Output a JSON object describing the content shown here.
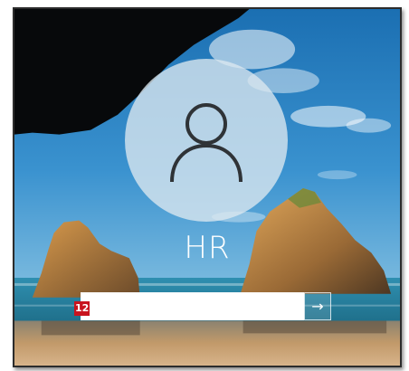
{
  "lock_screen": {
    "user_name": "HR",
    "password_value": "",
    "password_placeholder": "",
    "submit_glyph": "→",
    "step_badge": "12",
    "icons": {
      "avatar": "user-icon",
      "submit": "arrow-right-icon"
    },
    "colors": {
      "avatar_circle": "#dce8f0",
      "badge": "#c8141e",
      "input_background": "#ffffff",
      "text": "#ffffff"
    }
  }
}
